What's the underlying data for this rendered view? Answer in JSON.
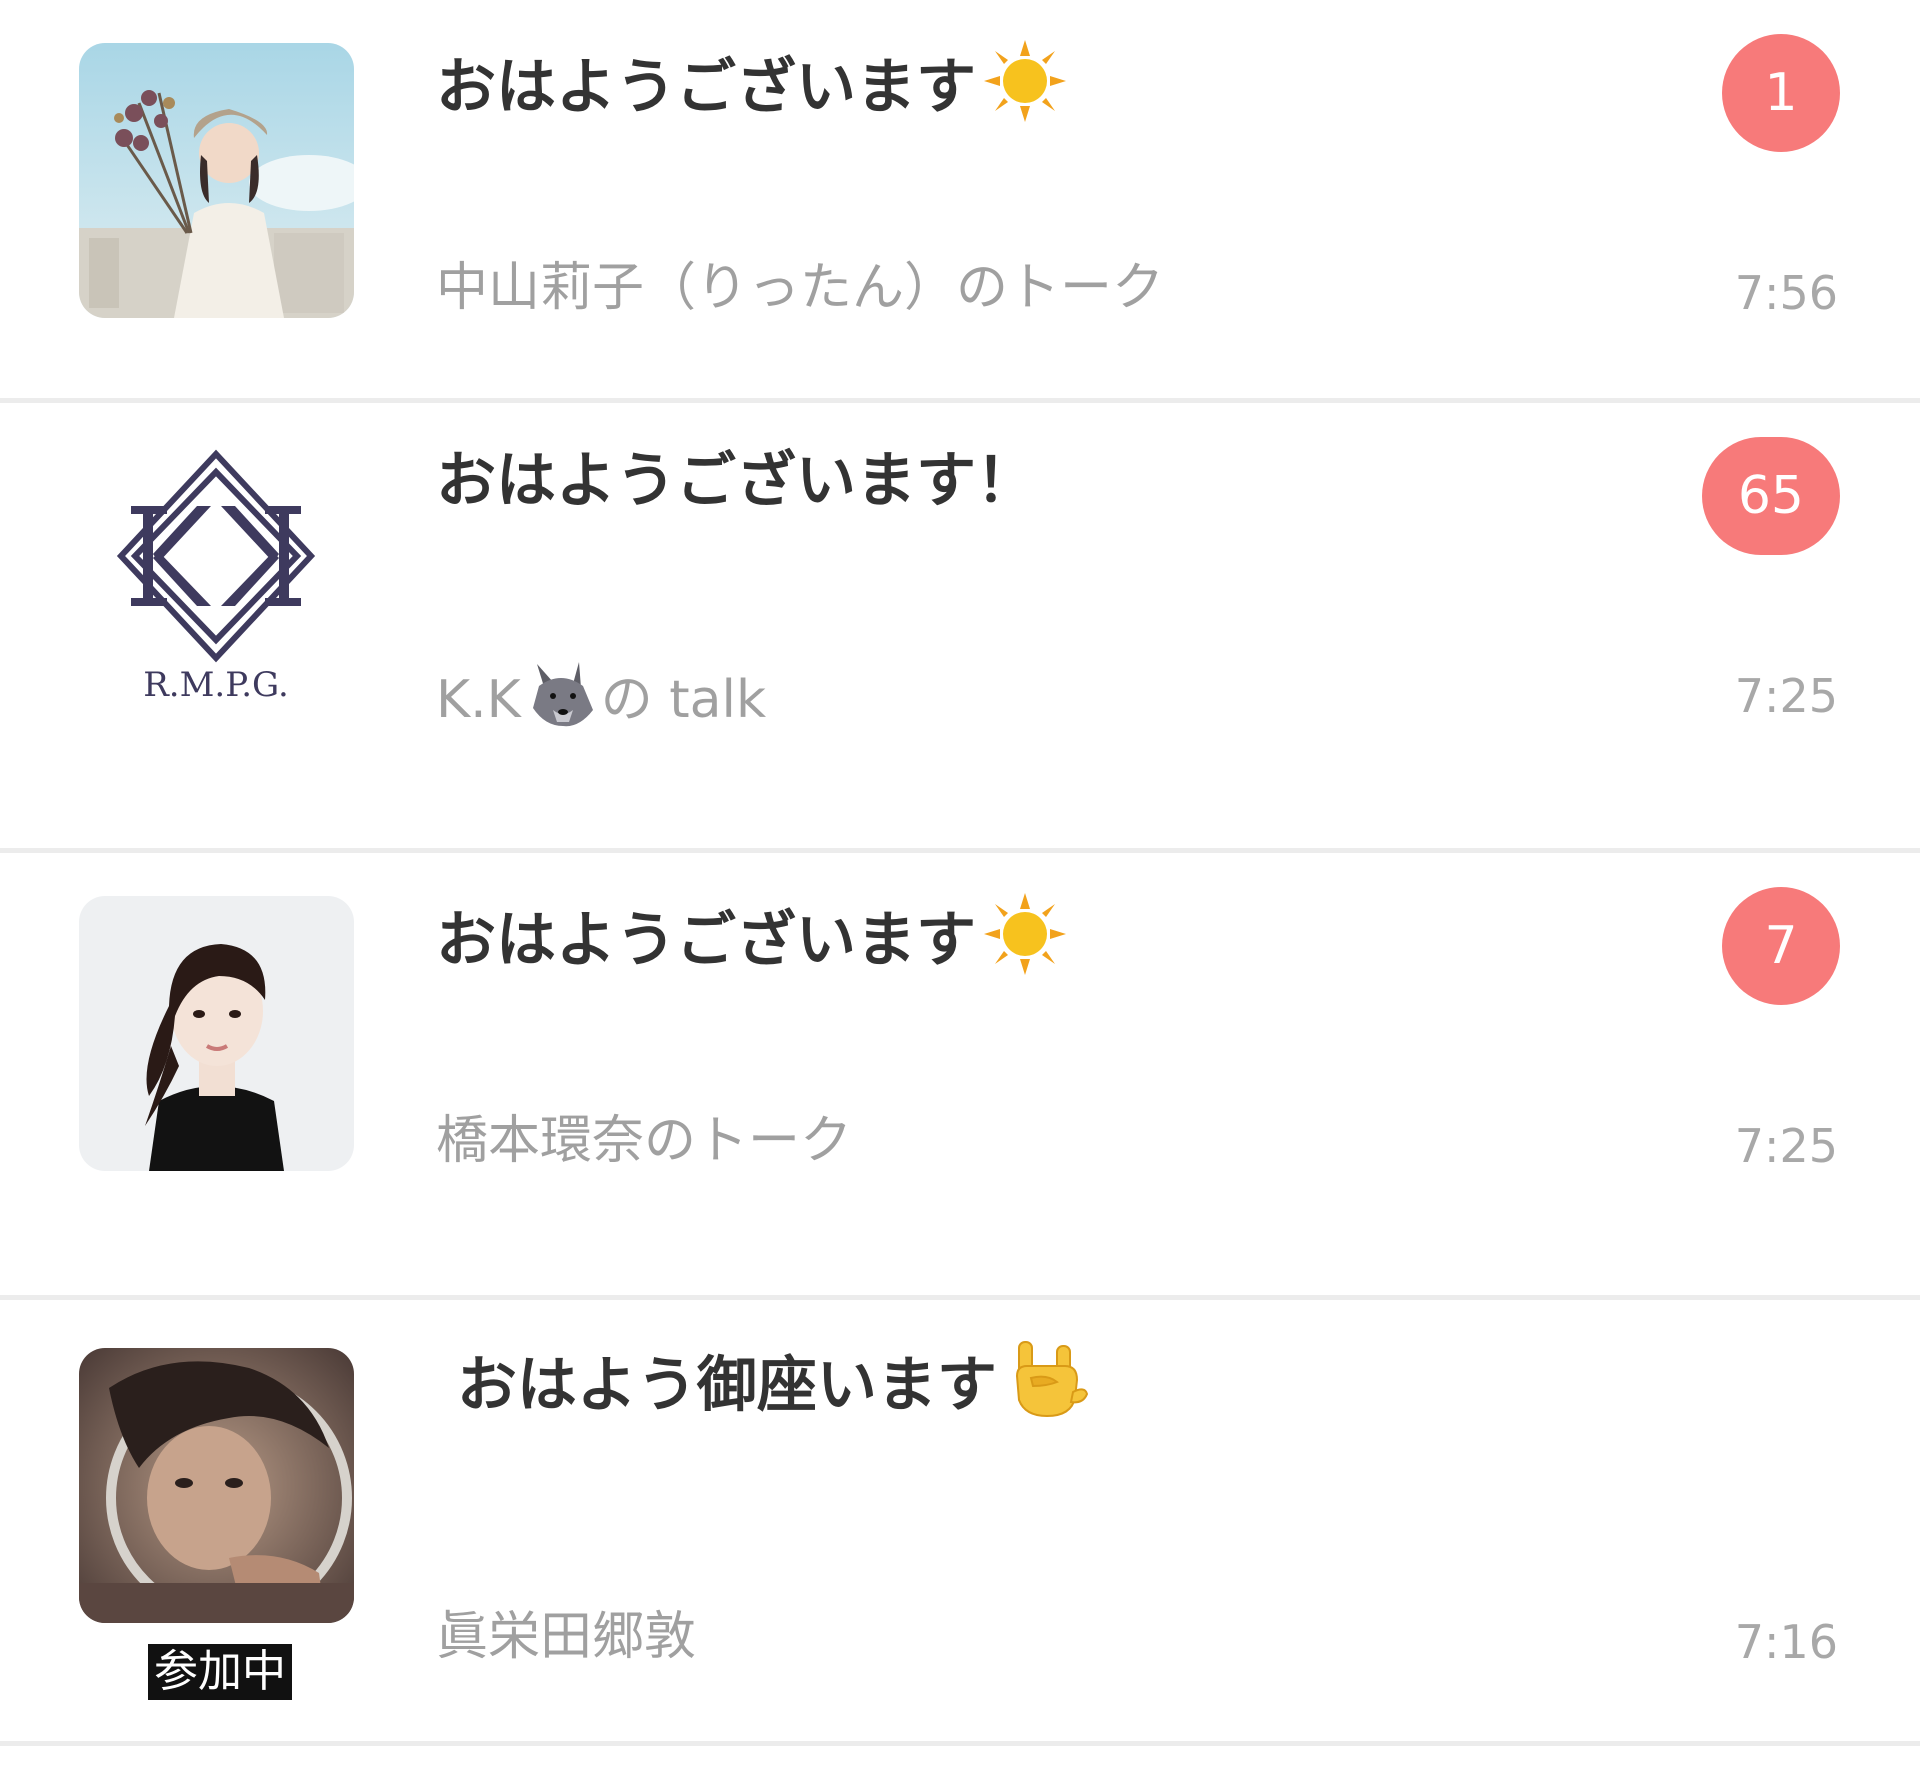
{
  "chats": [
    {
      "title": "おはようございます",
      "title_emoji": "sun-icon",
      "subtitle": "中山莉子（りったん）のトーク",
      "badge": "1",
      "time": "7:56"
    },
    {
      "title": "おはようございます！",
      "subtitle_prefix": "K.K",
      "subtitle_emoji": "wolf-icon",
      "subtitle_suffix": "の talk",
      "badge": "65",
      "time": "7:25",
      "avatar_logo_text": "R.M.P.G."
    },
    {
      "title": "おはようございます",
      "title_emoji": "sun-icon",
      "subtitle": "橋本環奈のトーク",
      "badge": "7",
      "time": "7:25"
    },
    {
      "title": " おはよう御座います",
      "title_emoji": "rock-hand-icon",
      "subtitle": "眞栄田郷敦",
      "time": "7:16",
      "status_label": "参加中"
    }
  ],
  "colors": {
    "badge": "#f77a7a",
    "divider": "#ececec",
    "title": "#333333",
    "subtitle": "#a0a0a0",
    "time": "#a8a8a8"
  }
}
